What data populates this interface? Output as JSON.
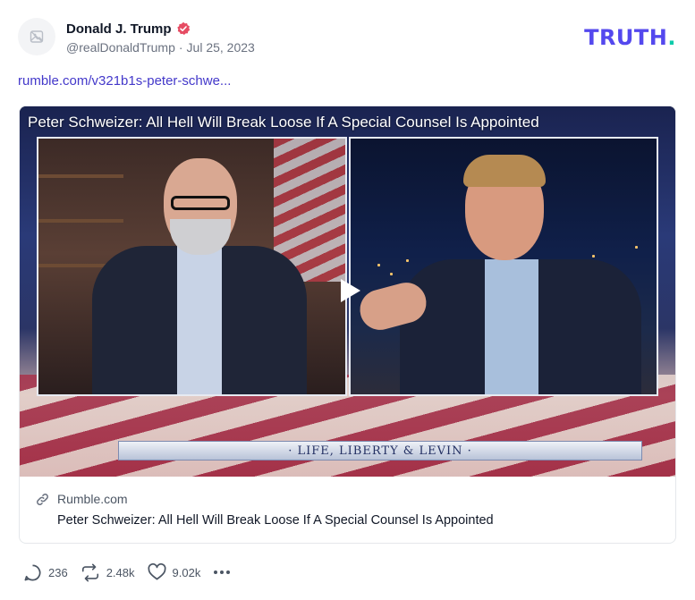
{
  "post": {
    "author_name": "Donald J. Trump",
    "handle": "@realDonaldTrump",
    "separator": "·",
    "date": "Jul 25, 2023",
    "link_text": "rumble.com/v321b1s-peter-schwe..."
  },
  "brand": {
    "text": "TRUTH",
    "dot": "."
  },
  "video": {
    "title": "Peter Schweizer: All Hell Will Break Loose If A Special Counsel Is Appointed",
    "banner": "· LIFE, LIBERTY & LEVIN ·"
  },
  "card": {
    "source": "Rumble.com",
    "title": "Peter Schweizer: All Hell Will Break Loose If A Special Counsel Is Appointed"
  },
  "actions": {
    "replies": "236",
    "retruths": "2.48k",
    "likes": "9.02k"
  },
  "colors": {
    "brand_purple": "#5448ee",
    "brand_teal": "#0ccbaa",
    "link": "#4338ca",
    "verified": "#e64c63"
  },
  "icons": [
    "avatar-placeholder-icon",
    "verified-badge-icon",
    "link-icon",
    "play-icon",
    "reply-icon",
    "retruth-icon",
    "like-icon",
    "more-icon"
  ]
}
